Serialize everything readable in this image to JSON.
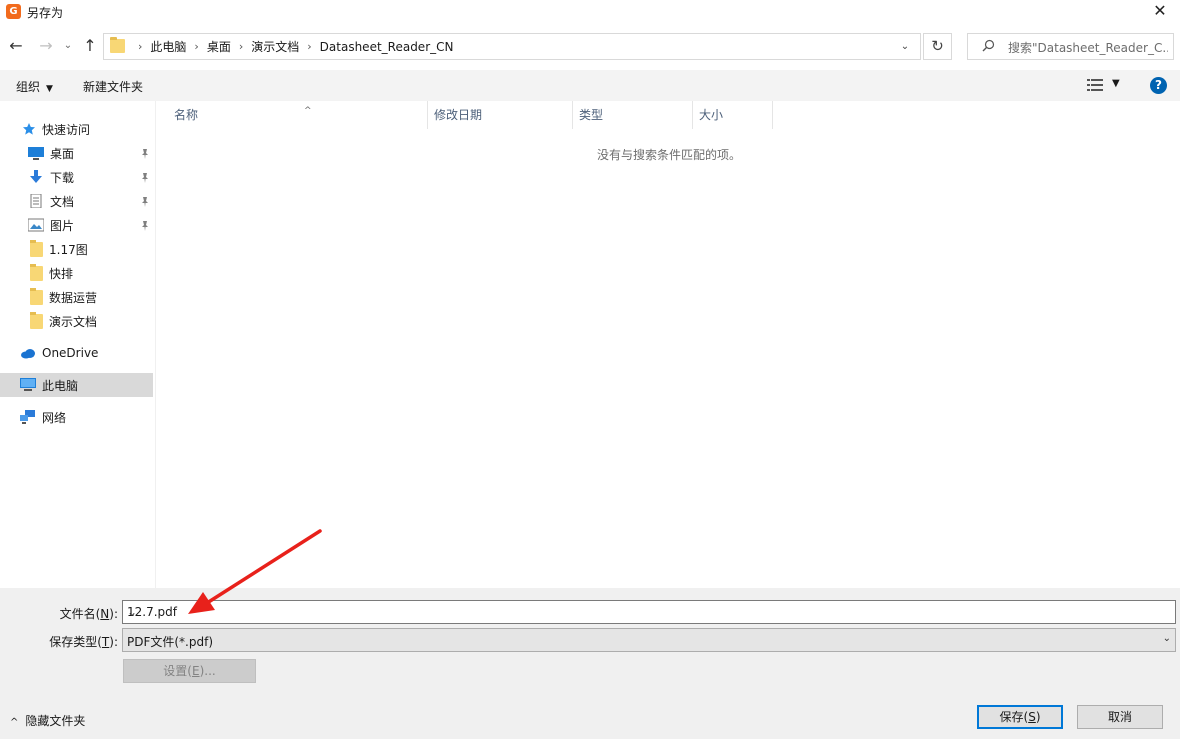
{
  "window": {
    "title": "另存为",
    "close_glyph": "✕"
  },
  "nav": {
    "back_glyph": "←",
    "forward_glyph": "→",
    "recent_glyph": "⌄",
    "up_glyph": "↑",
    "breadcrumbs": [
      "此电脑",
      "桌面",
      "演示文档",
      "Datasheet_Reader_CN"
    ],
    "breadcrumb_sep": "›",
    "dropdown_glyph": "⌄",
    "refresh_glyph": "↻",
    "search_placeholder": "搜索\"Datasheet_Reader_C..."
  },
  "commands": {
    "organize": "组织",
    "organize_caret": "▼",
    "new_folder": "新建文件夹",
    "view_caret": "▼",
    "help": "?"
  },
  "sidebar": {
    "quick_access": "快速访问",
    "items": [
      {
        "label": "桌面",
        "icon": "desktop-icon",
        "pinned": true
      },
      {
        "label": "下载",
        "icon": "download-icon",
        "pinned": true
      },
      {
        "label": "文档",
        "icon": "document-icon",
        "pinned": true
      },
      {
        "label": "图片",
        "icon": "picture-icon",
        "pinned": true
      },
      {
        "label": "1.17图",
        "icon": "folder-icon",
        "pinned": false
      },
      {
        "label": "快排",
        "icon": "folder-icon",
        "pinned": false
      },
      {
        "label": "数据运营",
        "icon": "folder-icon",
        "pinned": false
      },
      {
        "label": "演示文档",
        "icon": "folder-icon",
        "pinned": false
      }
    ],
    "pin_glyph": "📌",
    "onedrive": "OneDrive",
    "this_pc": "此电脑",
    "network": "网络"
  },
  "filelist": {
    "columns": [
      "名称",
      "修改日期",
      "类型",
      "大小"
    ],
    "sort_glyph": "^",
    "empty_message": "没有与搜索条件匹配的项。"
  },
  "form": {
    "filename_label_pre": "文件名(",
    "filename_label_key": "N",
    "filename_label_post": "):",
    "filename_value": "12.7.pdf",
    "filetype_label_pre": "保存类型(",
    "filetype_label_key": "T",
    "filetype_label_post": "):",
    "filetype_value": "PDF文件(*.pdf)",
    "dropdown_glyph": "⌄",
    "settings_pre": "设置(",
    "settings_key": "E",
    "settings_post": ")...",
    "hide_folders": "隐藏文件夹",
    "hide_glyph": "^",
    "save_pre": "保存(",
    "save_key": "S",
    "save_post": ")",
    "cancel": "取消"
  },
  "colors": {
    "accent": "#0078d7",
    "annotation_arrow": "#e8211b",
    "folder": "#f8d775"
  }
}
